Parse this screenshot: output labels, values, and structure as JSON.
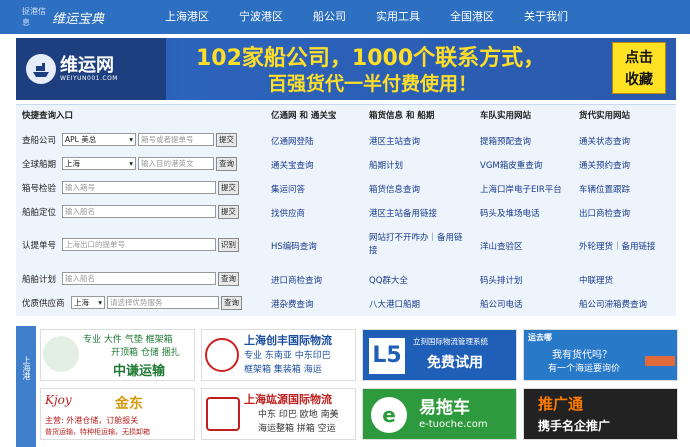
{
  "nav": {
    "logo_small": "捉港信息",
    "logo_main": "维运宝典",
    "items": [
      "上海港区",
      "宁波港区",
      "船公司",
      "实用工具",
      "全国港区",
      "关于我们"
    ]
  },
  "banner": {
    "brand_name": "维运网",
    "brand_url": "WEIYUN001.COM",
    "line1": "102家船公司，1000个联系方式，",
    "line2": "百强货代一半付费使用！",
    "cta_line1": "点击",
    "cta_line2": "收藏"
  },
  "query": {
    "heading": "快捷查询入口",
    "rows": [
      {
        "label": "查船公司",
        "select": "APL 美总",
        "input": "箱号或者提单号",
        "button": "提交"
      },
      {
        "label": "全球船期",
        "select": "上海",
        "input": "输入目的港英文",
        "button": "查询"
      },
      {
        "label": "箱号检验",
        "input": "输入箱号",
        "button": "提交"
      },
      {
        "label": "船舶定位",
        "input": "输入船名",
        "button": "提交"
      },
      {
        "label": "认提单号",
        "input": "上海出口的提单号",
        "button": "识别"
      },
      {
        "label": "船舶计划",
        "input": "输入船名",
        "button": "查询"
      },
      {
        "label": "优质供应商",
        "select": "上海",
        "input": "请选择优势服务",
        "button": "查询"
      }
    ]
  },
  "columns": [
    {
      "heading": "亿通网 和 通关宝",
      "links": [
        "亿通网登陆",
        "通关宝查询",
        "集运问答",
        "找供应商",
        "HS编码查询",
        "进口商检查询",
        "港杂费查询"
      ]
    },
    {
      "heading": "箱货信息 和 船期",
      "links": [
        "港区主站查询",
        "船期计划",
        "箱货信息查询",
        "港区主站备用链接",
        "网站打不开咋办｜备用链接",
        "QQ群大全",
        "八大港口船期"
      ]
    },
    {
      "heading": "车队实用网站",
      "links": [
        "提箱预配查询",
        "VGM箱皮重查询",
        "上海口岸电子EIR平台",
        "码头及堆场电话",
        "洋山查验区",
        "码头排计划",
        "船公司电话"
      ]
    },
    {
      "heading": "货代实用网站",
      "links": [
        "通关状态查询",
        "通关预约查询",
        "车辆位置跟踪",
        "出口商检查询",
        "外轮理货｜备用链接",
        "中联理货",
        "船公司滞箱费查询"
      ]
    }
  ],
  "sidebar": {
    "label": "上海港"
  },
  "ads": [
    {
      "line1": "专业 大件 气垫 框架箱",
      "line2": "开顶箱 仓储 捆扎",
      "line3": "中谦运输",
      "colors": [
        "#ffffff",
        "#1f7a33"
      ]
    },
    {
      "line1": "上海创丰国际物流",
      "line2": "专业 东南亚 中东印巴",
      "line3": "框架箱 集装箱 海运",
      "colors": [
        "#ffffff",
        "#1c4ea0"
      ]
    },
    {
      "line1": "立刻国际物流管理系统",
      "line2": "免费试用",
      "colors": [
        "#1f5fb8",
        "#ffffff"
      ]
    },
    {
      "line1": "运去哪",
      "line2": "我有货代吗？",
      "line3": "有一个海运要询价",
      "colors": [
        "#2979c9",
        "#ffffff"
      ]
    },
    {
      "line1": "金东",
      "line2": "主营: 外港仓储，订舱报关",
      "line3": "普货运输，特种柜运输，无损卸箱",
      "colors": [
        "#b82222",
        "#ffffff"
      ]
    },
    {
      "line1": "上海竑源国际物流",
      "line2": "中东 印巴 欧地 南美",
      "line3": "海运整箱 拼箱 空运",
      "colors": [
        "#ffffff",
        "#c01f1f"
      ]
    },
    {
      "line1": "易拖车",
      "line2": "e-tuoche.com",
      "colors": [
        "#2d9b3d",
        "#ffffff"
      ]
    },
    {
      "line1": "推广通",
      "line2": "携手名企推广",
      "colors": [
        "#222222",
        "#ffffff"
      ]
    }
  ]
}
